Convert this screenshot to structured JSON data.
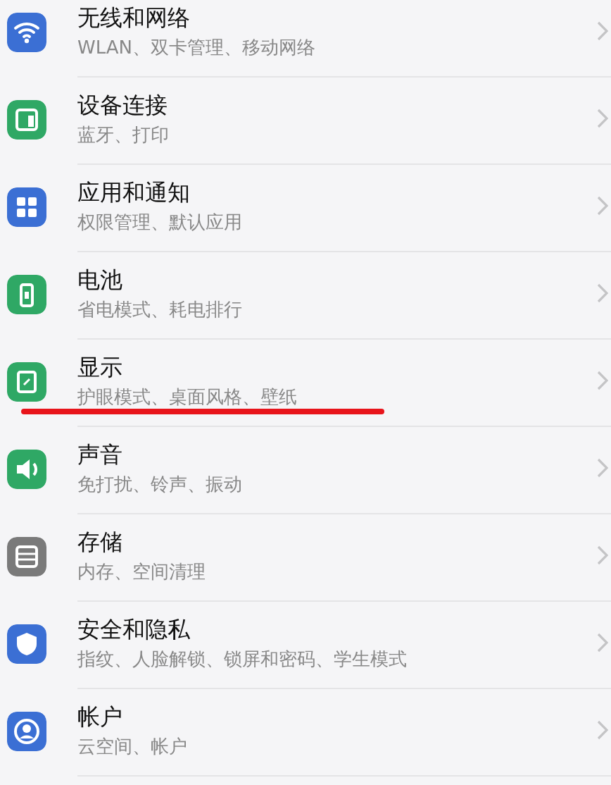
{
  "settings": [
    {
      "title": "无线和网络",
      "subtitle": "WLAN、双卡管理、移动网络",
      "color": "#3b6fd4",
      "underlined": false
    },
    {
      "title": "设备连接",
      "subtitle": "蓝牙、打印",
      "color": "#2fa865",
      "underlined": false
    },
    {
      "title": "应用和通知",
      "subtitle": "权限管理、默认应用",
      "color": "#3b6fd4",
      "underlined": false
    },
    {
      "title": "电池",
      "subtitle": "省电模式、耗电排行",
      "color": "#2fa865",
      "underlined": false
    },
    {
      "title": "显示",
      "subtitle": "护眼模式、桌面风格、壁纸",
      "color": "#2fa865",
      "underlined": true
    },
    {
      "title": "声音",
      "subtitle": "免打扰、铃声、振动",
      "color": "#2fa865",
      "underlined": false
    },
    {
      "title": "存储",
      "subtitle": "内存、空间清理",
      "color": "#7a7a7a",
      "underlined": false
    },
    {
      "title": "安全和隐私",
      "subtitle": "指纹、人脸解锁、锁屏和密码、学生模式",
      "color": "#3b6fd4",
      "underlined": false
    },
    {
      "title": "帐户",
      "subtitle": "云空间、帐户",
      "color": "#3b6fd4",
      "underlined": false
    }
  ]
}
